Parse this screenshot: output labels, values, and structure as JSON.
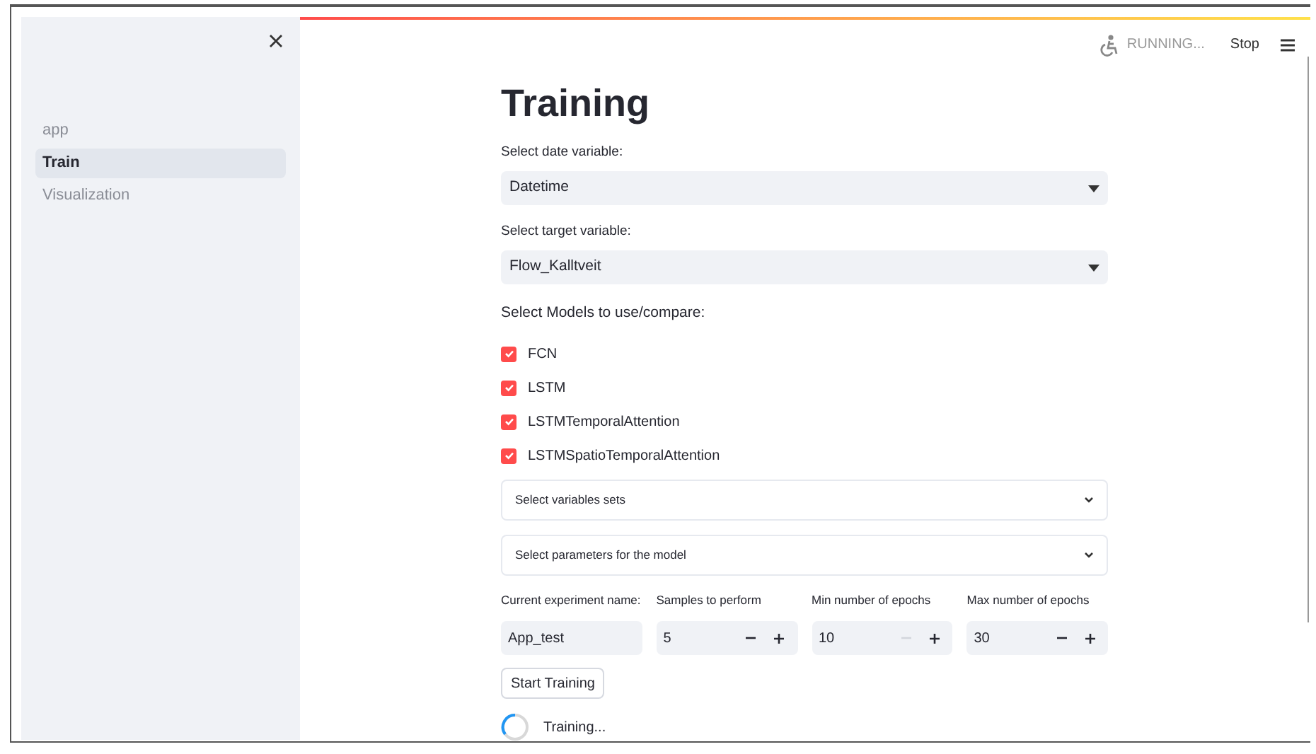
{
  "sidebar": {
    "items": [
      {
        "label": "app",
        "selected": false
      },
      {
        "label": "Train",
        "selected": true
      },
      {
        "label": "Visualization",
        "selected": false
      }
    ]
  },
  "header": {
    "status": "RUNNING...",
    "stop": "Stop"
  },
  "title": "Training",
  "selects": [
    {
      "label": "Select date variable:",
      "value": "Datetime"
    },
    {
      "label": "Select target variable:",
      "value": "Flow_Kalltveit"
    }
  ],
  "models": {
    "label": "Select Models to use/compare:",
    "items": [
      {
        "label": "FCN",
        "checked": true
      },
      {
        "label": "LSTM",
        "checked": true
      },
      {
        "label": "LSTMTemporalAttention",
        "checked": true
      },
      {
        "label": "LSTMSpatioTemporalAttention",
        "checked": true
      }
    ]
  },
  "expanders": [
    {
      "label": "Select variables sets",
      "expanded": false
    },
    {
      "label": "Select parameters for the model",
      "expanded": false
    }
  ],
  "fields": [
    {
      "kind": "text",
      "label": "Current experiment name:",
      "value": "App_test"
    },
    {
      "kind": "number",
      "label": "Samples to perform",
      "value": "5",
      "minus_disabled": false
    },
    {
      "kind": "number",
      "label": "Min number of epochs",
      "value": "10",
      "minus_disabled": true
    },
    {
      "kind": "number",
      "label": "Max number of epochs",
      "value": "30",
      "minus_disabled": false
    }
  ],
  "button": "Start Training",
  "spinner": "Training..."
}
